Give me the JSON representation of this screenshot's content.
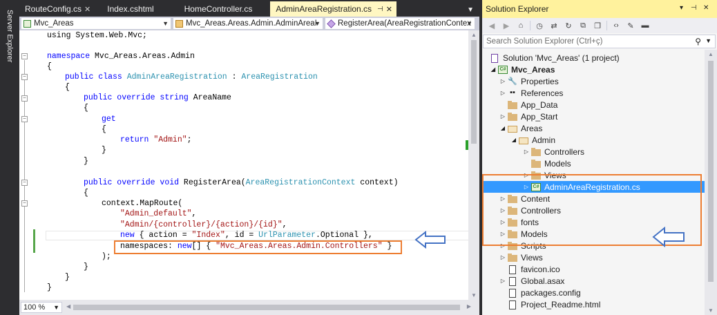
{
  "left_strip": {
    "label": "Server Explorer"
  },
  "editor": {
    "tabs": [
      {
        "label": "RouteConfig.cs",
        "active": false
      },
      {
        "label": "Index.cshtml",
        "active": false
      },
      {
        "label": "HomeController.cs",
        "active": false
      },
      {
        "label": "AdminAreaRegistration.cs",
        "active": true
      }
    ],
    "nav": {
      "project": "Mvc_Areas",
      "type": "Mvc_Areas.Areas.Admin.AdminAreaI",
      "member": "RegisterArea(AreaRegistrationContex"
    },
    "zoom": "100 %",
    "code": {
      "l1": "using System.Web.Mvc;",
      "l2_kw": "namespace",
      "l2_rest": " Mvc_Areas.Areas.Admin",
      "l3": "{",
      "l4_kw": "public class",
      "l4_ty1": "AdminAreaRegistration",
      "l4_mid": " : ",
      "l4_ty2": "AreaRegistration",
      "l5": "{",
      "l6_kw": "public override string",
      "l6_rest": " AreaName",
      "l7": "{",
      "l8_kw": "get",
      "l9": "{",
      "l10_kw": "return",
      "l10_str": "\"Admin\"",
      "l10_end": ";",
      "l11": "}",
      "l12": "}",
      "l13_kw": "public override void",
      "l13_mid": " RegisterArea(",
      "l13_ty": "AreaRegistrationContext",
      "l13_end": " context)",
      "l14": "{",
      "l15": "context.MapRoute(",
      "l16_str": "\"Admin_default\"",
      "l16_end": ",",
      "l17_str": "\"Admin/{controller}/{action}/{id}\"",
      "l17_end": ",",
      "l18_kw": "new",
      "l18_a": " { action = ",
      "l18_str": "\"Index\"",
      "l18_b": ", id = ",
      "l18_ty": "UrlParameter",
      "l18_c": ".Optional },",
      "l19_a": "namespaces: ",
      "l19_kw": "new",
      "l19_b": "[] { ",
      "l19_str": "\"Mvc_Areas.Areas.Admin.Controllers\"",
      "l19_c": " }",
      "l20": ");",
      "l21": "}",
      "l22": "}",
      "l23": "}"
    }
  },
  "solution_explorer": {
    "title": "Solution Explorer",
    "search_placeholder": "Search Solution Explorer (Ctrl+ç)",
    "tree": [
      {
        "label": "Solution 'Mvc_Areas' (1 project)"
      },
      {
        "label": "Mvc_Areas"
      },
      {
        "label": "Properties"
      },
      {
        "label": "References"
      },
      {
        "label": "App_Data"
      },
      {
        "label": "App_Start"
      },
      {
        "label": "Areas"
      },
      {
        "label": "Admin"
      },
      {
        "label": "Controllers"
      },
      {
        "label": "Models"
      },
      {
        "label": "Views"
      },
      {
        "label": "AdminAreaRegistration.cs"
      },
      {
        "label": "Content"
      },
      {
        "label": "Controllers"
      },
      {
        "label": "fonts"
      },
      {
        "label": "Models"
      },
      {
        "label": "Scripts"
      },
      {
        "label": "Views"
      },
      {
        "label": "favicon.ico"
      },
      {
        "label": "Global.asax"
      },
      {
        "label": "packages.config"
      },
      {
        "label": "Project_Readme.html"
      }
    ],
    "selected_item": "AdminAreaRegistration.cs"
  },
  "colors": {
    "highlight_box": "#ed7d31",
    "callout_arrow": "#4472c4",
    "selection": "#3399ff",
    "title_active": "#fff29d"
  }
}
